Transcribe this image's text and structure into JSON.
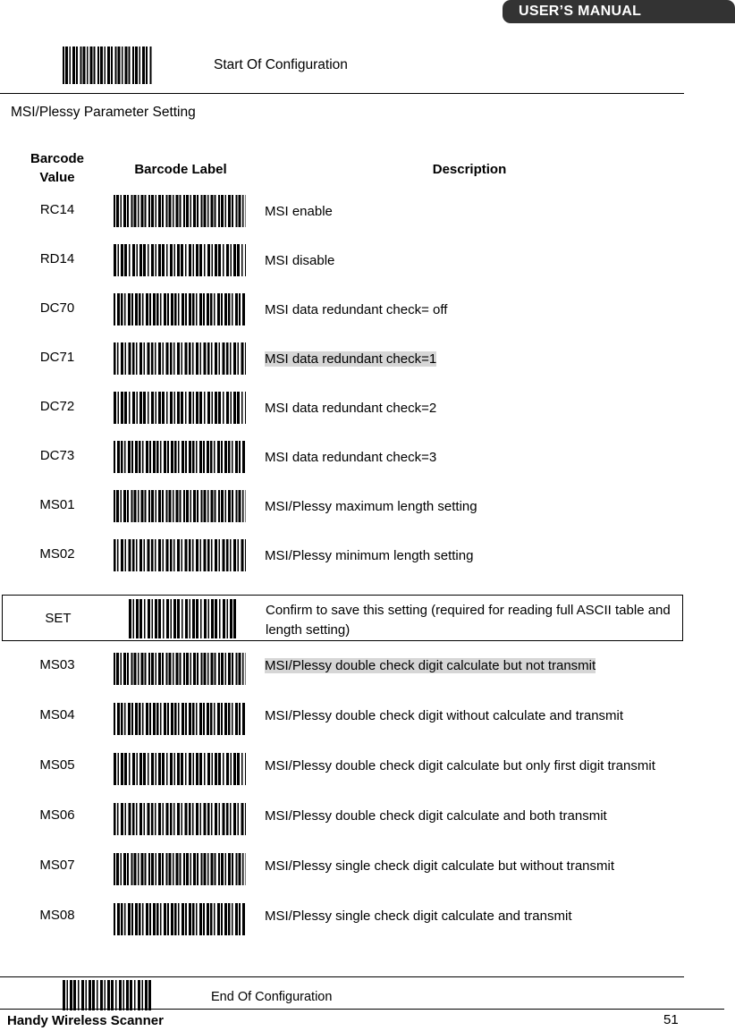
{
  "header": {
    "title": "USER’S MANUAL",
    "bar_color": "#333333",
    "text_color": "#ffffff"
  },
  "start_config": {
    "label": "Start Of Configuration",
    "barcode_icon": "barcode-icon"
  },
  "section": {
    "title": "MSI/Plessy Parameter Setting"
  },
  "table": {
    "headers": {
      "barcode_value": "Barcode\nValue",
      "barcode_value_line1": "Barcode",
      "barcode_value_line2": "Value",
      "barcode_label": "Barcode Label",
      "description": "Description"
    },
    "highlight_color": "#d6d6d6",
    "rows": [
      {
        "code": "RC14",
        "description": "MSI enable",
        "highlight": false,
        "barcode_icon": "barcode-icon"
      },
      {
        "code": "RD14",
        "description": "MSI disable",
        "highlight": false,
        "barcode_icon": "barcode-icon"
      },
      {
        "code": "DC70",
        "description": "MSI data redundant check= off",
        "highlight": false,
        "barcode_icon": "barcode-icon"
      },
      {
        "code": "DC71",
        "description": "MSI data redundant check=1",
        "highlight": true,
        "barcode_icon": "barcode-icon"
      },
      {
        "code": "DC72",
        "description": "MSI data redundant check=2",
        "highlight": false,
        "barcode_icon": "barcode-icon"
      },
      {
        "code": "DC73",
        "description": "MSI data redundant check=3",
        "highlight": false,
        "barcode_icon": "barcode-icon"
      },
      {
        "code": "MS01",
        "description": "MSI/Plessy maximum length setting",
        "highlight": false,
        "barcode_icon": "barcode-icon"
      },
      {
        "code": "MS02",
        "description": "MSI/Plessy minimum length setting",
        "highlight": false,
        "barcode_icon": "barcode-icon"
      }
    ],
    "set_row": {
      "code": "SET",
      "description": "Confirm to save this setting (required for reading full ASCII table and length setting)",
      "boxed": true,
      "barcode_icon": "barcode-icon"
    },
    "rows2": [
      {
        "code": "MS03",
        "description": "MSI/Plessy double check digit calculate but not transmit",
        "highlight": true,
        "barcode_icon": "barcode-icon"
      },
      {
        "code": "MS04",
        "description": "MSI/Plessy double check digit without calculate and transmit",
        "highlight": false,
        "barcode_icon": "barcode-icon"
      },
      {
        "code": "MS05",
        "description": "MSI/Plessy double check digit calculate but only first digit    transmit",
        "highlight": false,
        "barcode_icon": "barcode-icon"
      },
      {
        "code": "MS06",
        "description": "MSI/Plessy double check digit calculate and both transmit",
        "highlight": false,
        "barcode_icon": "barcode-icon"
      },
      {
        "code": "MS07",
        "description": "MSI/Plessy single check digit calculate but without transmit",
        "highlight": false,
        "barcode_icon": "barcode-icon"
      },
      {
        "code": "MS08",
        "description": "MSI/Plessy single check digit calculate and transmit",
        "highlight": false,
        "barcode_icon": "barcode-icon"
      }
    ]
  },
  "end_config": {
    "label": "End Of Configuration",
    "barcode_icon": "barcode-icon"
  },
  "footer": {
    "product": "Handy Wireless Scanner",
    "page_number": "51"
  }
}
